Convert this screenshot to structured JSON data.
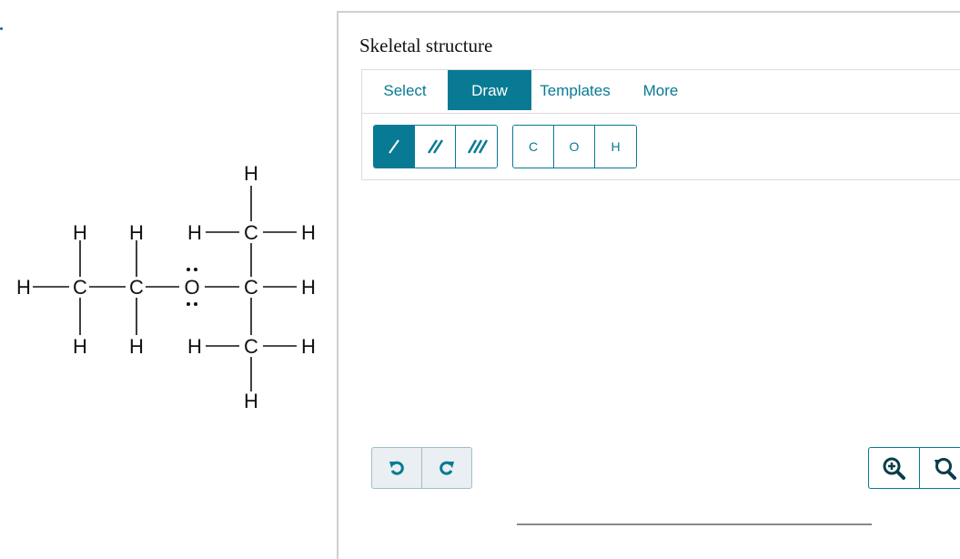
{
  "question": {
    "molecule_atoms": {
      "h_top": "H",
      "h_upper_left1": "H",
      "h_upper_left2": "H",
      "h_upper_mid": "H",
      "c_upper": "C",
      "h_upper_right": "H",
      "h_far_left": "H",
      "c_left1": "C",
      "c_left2": "C",
      "o_center": "O",
      "c_center": "C",
      "h_center_right": "H",
      "h_lower_left1": "H",
      "h_lower_left2": "H",
      "h_lower_mid": "H",
      "c_lower": "C",
      "h_lower_right": "H",
      "h_bottom": "H"
    }
  },
  "panel": {
    "title": "Skeletal structure",
    "tabs": [
      {
        "label": "Select",
        "active": false
      },
      {
        "label": "Draw",
        "active": true
      },
      {
        "label": "Templates",
        "active": false
      },
      {
        "label": "More",
        "active": false
      }
    ],
    "bond_tools": [
      "single-bond",
      "double-bond",
      "triple-bond"
    ],
    "atom_tools": [
      "C",
      "O",
      "H"
    ],
    "icons": {
      "undo": "undo-icon",
      "redo": "redo-icon",
      "zoom_in": "zoom-in-icon",
      "zoom_reset": "zoom-reset-icon"
    },
    "colors": {
      "accent": "#087a94",
      "disabled": "#e9eff2"
    }
  }
}
